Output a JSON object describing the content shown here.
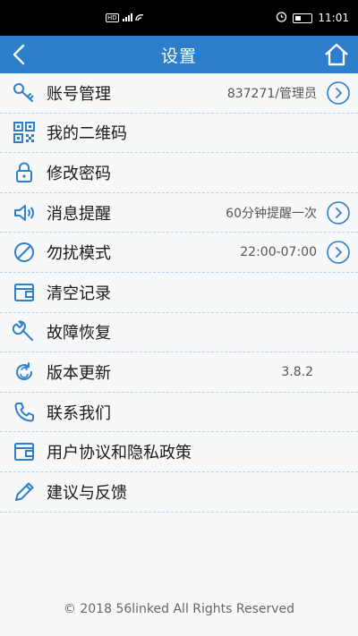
{
  "status_bar": {
    "left_badge": "HD",
    "signal_label": "4G",
    "time": "11:01"
  },
  "header": {
    "title": "设置",
    "back_icon": "chevron-left-icon",
    "home_icon": "home-icon"
  },
  "menu": [
    {
      "label": "账号管理",
      "value": "837271/管理员",
      "icon": "key-icon",
      "has_arrow": true
    },
    {
      "label": "我的二维码",
      "value": "",
      "icon": "qr-code-icon",
      "has_arrow": false
    },
    {
      "label": "修改密码",
      "value": "",
      "icon": "lock-icon",
      "has_arrow": false
    },
    {
      "label": "消息提醒",
      "value": "60分钟提醒一次",
      "icon": "speaker-icon",
      "has_arrow": true
    },
    {
      "label": "勿扰模式",
      "value": "22:00-07:00",
      "icon": "no-disturb-icon",
      "has_arrow": true
    },
    {
      "label": "清空记录",
      "value": "",
      "icon": "wallet-icon",
      "has_arrow": false
    },
    {
      "label": "故障恢复",
      "value": "",
      "icon": "wrench-icon",
      "has_arrow": false
    },
    {
      "label": "版本更新",
      "value": "3.8.2",
      "icon": "update-icon",
      "has_arrow": false
    },
    {
      "label": "联系我们",
      "value": "",
      "icon": "phone-icon",
      "has_arrow": false
    },
    {
      "label": "用户协议和隐私政策",
      "value": "",
      "icon": "wallet-icon",
      "has_arrow": false
    },
    {
      "label": "建议与反馈",
      "value": "",
      "icon": "pencil-icon",
      "has_arrow": false
    }
  ],
  "footer": {
    "copyright": "© 2018 56linked All Rights Reserved"
  },
  "colors": {
    "primary": "#2e7fcb",
    "divider": "#b9d2ea"
  }
}
